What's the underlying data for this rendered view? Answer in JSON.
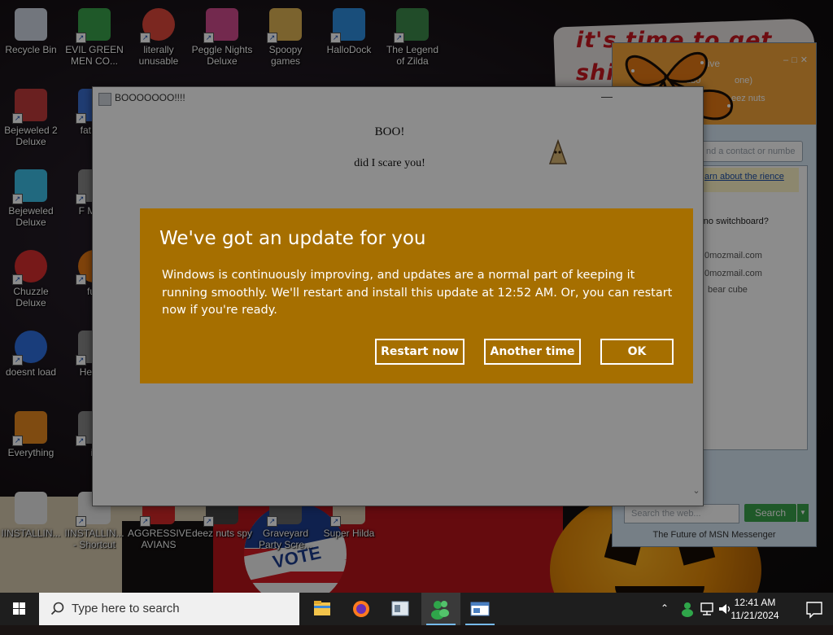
{
  "desktop": {
    "wallpaper_note": "it's time to get shit and",
    "vote_text": "VOTE",
    "icons": [
      {
        "id": "recycle",
        "label": "Recycle Bin",
        "icon": "recycle-bin-icon"
      },
      {
        "id": "evil",
        "label": "EVIL GREEN MEN CO...",
        "icon": "green-men-icon"
      },
      {
        "id": "chrome",
        "label": "literally unusable",
        "icon": "chrome-icon"
      },
      {
        "id": "peggle",
        "label": "Peggle Nights Deluxe",
        "icon": "peggle-icon"
      },
      {
        "id": "spoopy",
        "label": "Spoopy games",
        "icon": "folder-icon"
      },
      {
        "id": "hallo",
        "label": "HalloDock",
        "icon": "windows-logo-icon"
      },
      {
        "id": "zilda",
        "label": "The Legend of Zilda",
        "icon": "zilda-icon"
      },
      {
        "id": "bejeweled2",
        "label": "Bejeweled 2 Deluxe",
        "icon": "bejeweled2-icon"
      },
      {
        "id": "fatlike",
        "label": "fat like",
        "icon": "fat-icon"
      },
      {
        "id": "bejeweled",
        "label": "Bejeweled Deluxe",
        "icon": "gem-icon"
      },
      {
        "id": "fmon",
        "label": "F MON",
        "icon": "game-icon"
      },
      {
        "id": "chuzzle",
        "label": "Chuzzle Deluxe",
        "icon": "chuzzle-icon"
      },
      {
        "id": "furr",
        "label": "furr",
        "icon": "fox-icon"
      },
      {
        "id": "doesnt",
        "label": "doesnt load",
        "icon": "thunderbird-icon"
      },
      {
        "id": "hewe",
        "label": "He We",
        "icon": "game-icon"
      },
      {
        "id": "everything",
        "label": "Everything",
        "icon": "magnifier-icon"
      },
      {
        "id": "is",
        "label": "is",
        "icon": "game-icon"
      },
      {
        "id": "installing1",
        "label": "IINSTALLIN...",
        "icon": "document-icon"
      },
      {
        "id": "installing2",
        "label": "IINSTALLIN... - Shortcut",
        "icon": "document-icon"
      },
      {
        "id": "aggressive",
        "label": "AGGRESSIVE AVIANS",
        "icon": "angry-bird-icon"
      },
      {
        "id": "deeznuts",
        "label": "deez nuts spy",
        "icon": "spy-icon"
      },
      {
        "id": "graveyard",
        "label": "Graveyard Party Scre...",
        "icon": "graveyard-icon"
      },
      {
        "id": "hilda",
        "label": "Super Hilda",
        "icon": "hilda-icon"
      }
    ]
  },
  "msn": {
    "title": "Live",
    "subtitle_a": "ub0",
    "subtitle_b": "one)",
    "subtitle_c": "eez nuts",
    "search_contact": "nd a contact or numbe",
    "banner_link": "arn about the rience",
    "switchboard": "- no switchboard?",
    "contacts": [
      "0mozmail.com",
      "0mozmail.com",
      "bear cube"
    ],
    "web_search_placeholder": "Search the web...",
    "search_button": "Search",
    "footer": "The Future of MSN Messenger"
  },
  "dialog": {
    "title": "BOOOOOOO!!!!",
    "heading": "BOO!",
    "body": "did I scare you!"
  },
  "update": {
    "title": "We've got an update for you",
    "text": "Windows is continuously improving, and updates are a normal part of keeping it running smoothly. We'll restart and install this update at 12:52 AM. Or, you can restart now if you're ready.",
    "buttons": {
      "restart": "Restart now",
      "another": "Another time",
      "ok": "OK"
    },
    "accent": "#a66f00"
  },
  "taskbar": {
    "search_placeholder": "Type here to search",
    "apps": [
      "file-explorer-icon",
      "firefox-icon",
      "app-window-icon",
      "msn-messenger-icon",
      "dialog-app-icon"
    ],
    "time": "12:41 AM",
    "date": "11/21/2024"
  }
}
